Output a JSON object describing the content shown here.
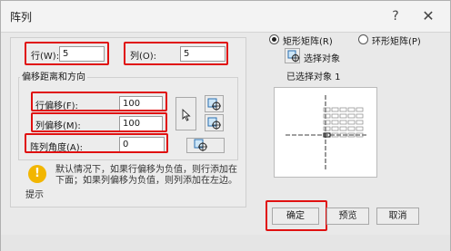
{
  "window": {
    "title": "阵列",
    "help_glyph": "?",
    "close_glyph": "✕"
  },
  "grid": {
    "rows_label": "行(W):",
    "rows_value": "5",
    "cols_label": "列(O):",
    "cols_value": "5"
  },
  "offset": {
    "group_title": "偏移距离和方向",
    "row_offset_label": "行偏移(F):",
    "row_offset_value": "100",
    "col_offset_label": "列偏移(M):",
    "col_offset_value": "100",
    "angle_label": "阵列角度(A):",
    "angle_value": "0"
  },
  "hint": {
    "icon_glyph": "!",
    "text": "默认情况下，如果行偏移为负值，则行添加在下面；如果列偏移为负值，则列添加在左边。",
    "label": "提示"
  },
  "mode": {
    "rect_label": "矩形矩阵(R)",
    "polar_label": "环形矩阵(P)",
    "selected": "rect"
  },
  "selection": {
    "select_label": "选择对象",
    "status": "已选择对象 1"
  },
  "buttons": {
    "ok": "确定",
    "preview": "预览",
    "cancel": "取消"
  },
  "colors": {
    "highlight": "#e01010",
    "hint_icon": "#f2b600"
  }
}
